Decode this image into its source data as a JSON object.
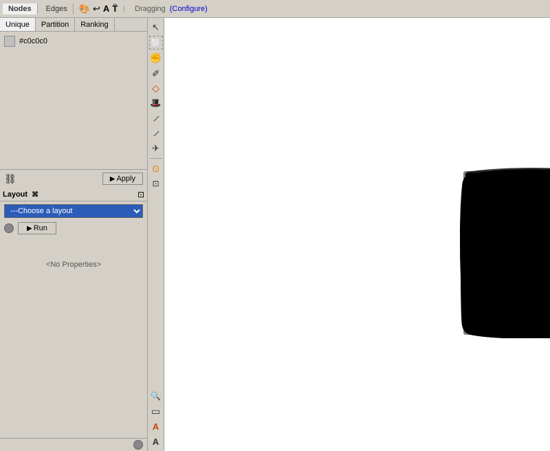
{
  "topbar": {
    "tabs": [
      {
        "id": "nodes",
        "label": "Nodes",
        "active": false
      },
      {
        "id": "edges",
        "label": "Edges",
        "active": false
      }
    ],
    "icon_tabs": [
      {
        "id": "color",
        "icon": "🎨",
        "label": "color-icon"
      },
      {
        "id": "history",
        "icon": "↩",
        "label": "history-icon"
      },
      {
        "id": "text",
        "icon": "A",
        "label": "text-icon"
      },
      {
        "id": "text2",
        "icon": "T̈",
        "label": "text2-icon"
      }
    ],
    "mode": "Dragging",
    "configure": "(Configure)"
  },
  "sub_tabs": [
    {
      "label": "Unique",
      "active": true
    },
    {
      "label": "Partition",
      "active": false
    },
    {
      "label": "Ranking",
      "active": false
    }
  ],
  "color_entries": [
    {
      "color": "#c0c0c0",
      "label": "#c0c0c0"
    }
  ],
  "apply_button": "Apply",
  "layout_panel": {
    "title": "Layout",
    "shortcut": "⌘",
    "dropdown_placeholder": "---Choose a layout",
    "run_button": "Run",
    "no_properties": "<No Properties>"
  },
  "toolbar_tools": [
    {
      "id": "select",
      "icon": "↖",
      "label": "select-tool"
    },
    {
      "id": "rect-select",
      "icon": "⬜",
      "label": "rect-select-tool"
    },
    {
      "id": "grab",
      "icon": "✋",
      "label": "grab-tool"
    },
    {
      "id": "pencil",
      "icon": "✏",
      "label": "pencil-tool"
    },
    {
      "id": "gem",
      "icon": "◇",
      "label": "gem-tool"
    },
    {
      "id": "magic",
      "icon": "✨",
      "label": "magic-tool"
    },
    {
      "id": "line",
      "icon": "╱",
      "label": "line-tool"
    },
    {
      "id": "line2",
      "icon": "╱",
      "label": "line2-tool"
    },
    {
      "id": "plane",
      "icon": "✈",
      "label": "plane-tool"
    },
    {
      "id": "target",
      "icon": "⊙",
      "label": "target-tool"
    },
    {
      "id": "lasso",
      "icon": "⊡",
      "label": "lasso-tool"
    },
    {
      "id": "zoom",
      "icon": "🔍",
      "label": "zoom-tool"
    },
    {
      "id": "rect",
      "icon": "▭",
      "label": "rect-tool"
    },
    {
      "id": "font-a",
      "icon": "A",
      "label": "font-a-tool"
    },
    {
      "id": "font-a2",
      "icon": "A",
      "label": "font-a2-tool"
    }
  ]
}
